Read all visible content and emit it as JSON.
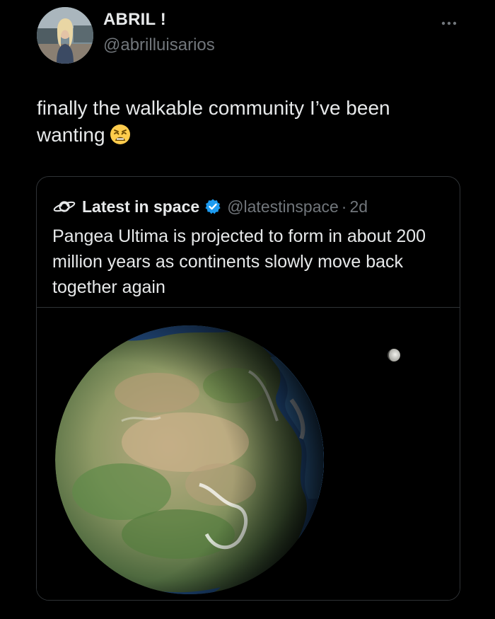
{
  "author": {
    "name": "ABRIL !",
    "handle": "@abrilluisarios"
  },
  "tweet": {
    "text": "finally the walkable community I’ve been wanting",
    "emoji": "weary-face"
  },
  "quoted": {
    "name": "Latest in space",
    "verified": true,
    "handle": "@latestinspace",
    "separator": "·",
    "time": "2d",
    "text": "Pangea Ultima is projected to form in about 200 million years as continents slowly move back together again"
  },
  "icons": {
    "more": "more-horizontal-icon",
    "verified": "verified-badge-icon",
    "quoted_avatar": "saturn-logo-icon"
  },
  "colors": {
    "background": "#000000",
    "primary_text": "#e7e9ea",
    "secondary_text": "#71767b",
    "border": "#2f3336",
    "verified_blue": "#1d9bf0"
  }
}
